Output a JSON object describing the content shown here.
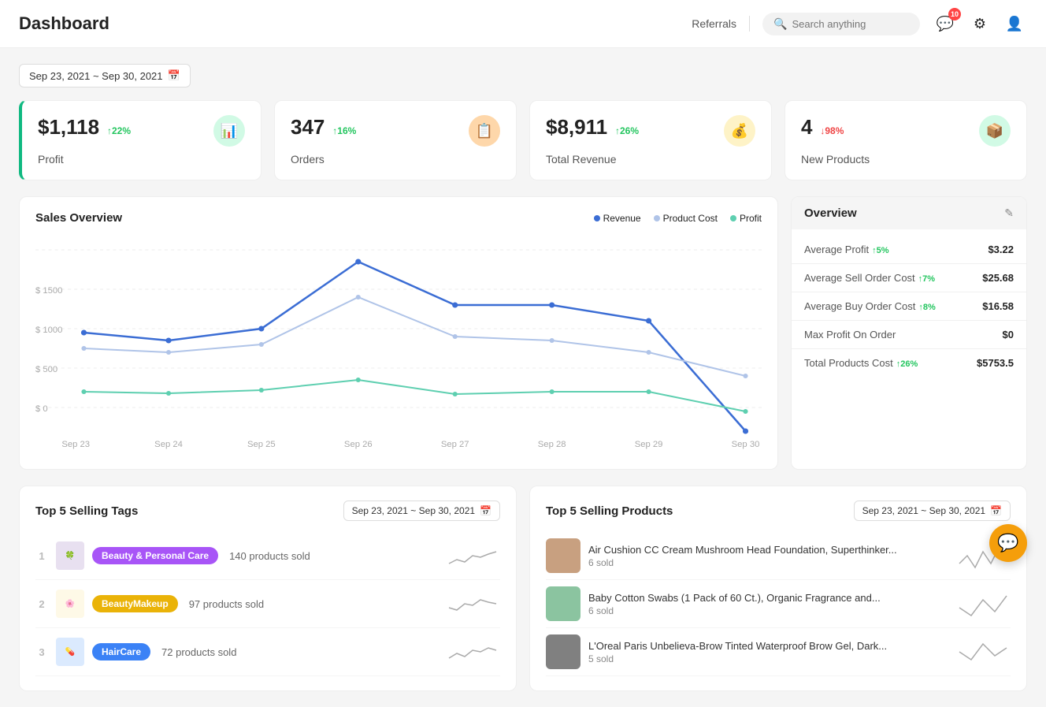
{
  "header": {
    "title": "Dashboard",
    "referrals": "Referrals",
    "search_placeholder": "Search anything",
    "notification_count": "10"
  },
  "date_range": {
    "label": "Sep 23, 2021 ~ Sep 30, 2021"
  },
  "kpi_cards": [
    {
      "id": "profit",
      "value": "$1,118",
      "change": "↑22%",
      "change_dir": "up",
      "label": "Profit",
      "icon": "📊",
      "icon_class": "green"
    },
    {
      "id": "orders",
      "value": "347",
      "change": "↑16%",
      "change_dir": "up",
      "label": "Orders",
      "icon": "📋",
      "icon_class": "orange"
    },
    {
      "id": "revenue",
      "value": "$8,911",
      "change": "↑26%",
      "change_dir": "up",
      "label": "Total Revenue",
      "icon": "💲",
      "icon_class": "amber"
    },
    {
      "id": "new_products",
      "value": "4",
      "change": "↓98%",
      "change_dir": "down",
      "label": "New Products",
      "icon": "📦",
      "icon_class": "teal"
    }
  ],
  "sales_overview": {
    "title": "Sales Overview",
    "legend": [
      {
        "label": "Revenue",
        "color": "#3b6dd4"
      },
      {
        "label": "Product Cost",
        "color": "#b0c4e8"
      },
      {
        "label": "Profit",
        "color": "#5ecfb0"
      }
    ]
  },
  "overview_panel": {
    "title": "Overview",
    "rows": [
      {
        "key": "Average Profit",
        "change": "↑5%",
        "value": "$3.22"
      },
      {
        "key": "Average Sell Order Cost",
        "change": "↑7%",
        "value": "$25.68"
      },
      {
        "key": "Average Buy Order Cost",
        "change": "↑8%",
        "value": "$16.58"
      },
      {
        "key": "Max Profit On Order",
        "change": "",
        "value": "$0"
      },
      {
        "key": "Total Products Cost",
        "change": "↑26%",
        "value": "$5753.5"
      }
    ]
  },
  "top_tags": {
    "title": "Top 5 Selling Tags",
    "date_range": "Sep 23, 2021 ~ Sep 30, 2021",
    "items": [
      {
        "rank": "1",
        "label": "Beauty & Personal Care",
        "color": "#a855f7",
        "sold": "140 products sold"
      },
      {
        "rank": "2",
        "label": "BeautyMakeup",
        "color": "#eab308",
        "sold": "97 products sold"
      },
      {
        "rank": "3",
        "label": "HairCare",
        "color": "#3b82f6",
        "sold": "72 products sold"
      }
    ]
  },
  "top_products": {
    "title": "Top 5 Selling Products",
    "date_range": "Sep 23, 2021 ~ Sep 30, 2021",
    "items": [
      {
        "name": "Air Cushion CC Cream Mushroom Head Foundation, Superthinker...",
        "sold": "6 sold",
        "img_color": "#c8a080"
      },
      {
        "name": "Baby Cotton Swabs (1 Pack of 60 Ct.), Organic Fragrance and...",
        "sold": "6 sold",
        "img_color": "#8bc4a0"
      },
      {
        "name": "L'Oreal Paris Unbelieva-Brow Tinted Waterproof Brow Gel, Dark...",
        "sold": "5 sold",
        "img_color": "#808080"
      }
    ]
  }
}
